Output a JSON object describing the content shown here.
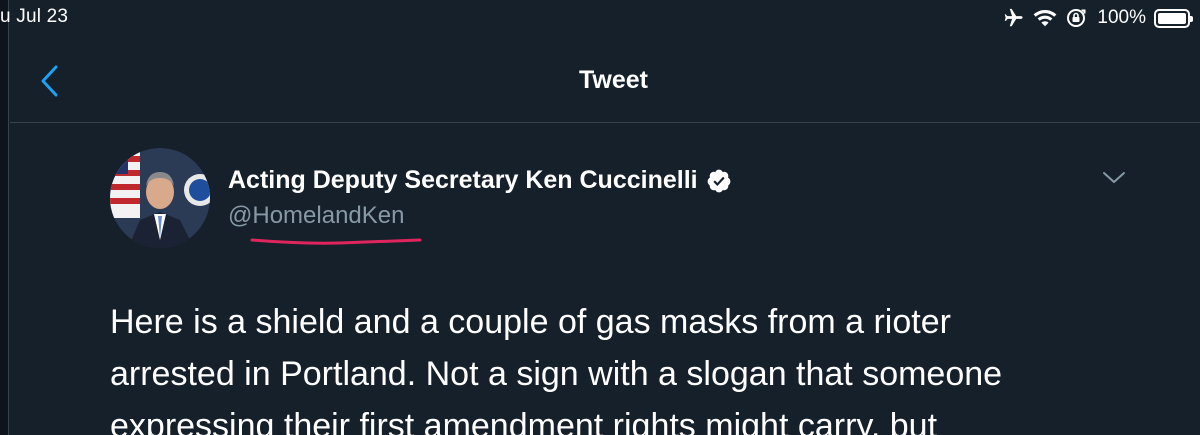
{
  "status_bar": {
    "date": "u Jul 23",
    "battery_percent": "100%",
    "battery_level": 1.0,
    "icons": [
      "airplane-icon",
      "wifi-icon",
      "orientation-lock-icon",
      "battery-icon"
    ]
  },
  "nav": {
    "title": "Tweet",
    "back_icon": "chevron-left-icon"
  },
  "tweet": {
    "author_name": "Acting Deputy Secretary Ken Cuccinelli",
    "author_handle": "@HomelandKen",
    "verified": true,
    "text_lines": [
      "Here is a shield and a couple of gas masks from a rioter",
      "arrested in Portland. Not a sign with a slogan that someone",
      "expressing their first amendment rights might carry, but"
    ]
  },
  "colors": {
    "background": "#15202b",
    "divider": "#38444d",
    "accent": "#1da1f2",
    "secondary_text": "#8899a6",
    "annotation_red": "#e0245e"
  }
}
